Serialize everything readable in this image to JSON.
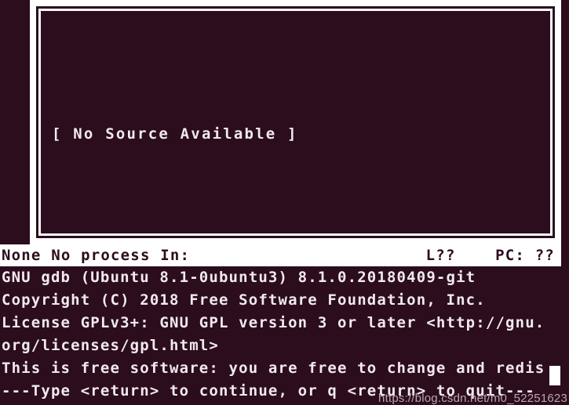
{
  "terminal": {
    "background_color": "#2b0d1e",
    "foreground_color": "#f2e9ee"
  },
  "source_window": {
    "placeholder_text": "[ No Source Available ]"
  },
  "status_bar": {
    "left_text": "None No process In:",
    "line_indicator": "L??",
    "pc_indicator": "PC: ??"
  },
  "console": {
    "lines": [
      "GNU gdb (Ubuntu 8.1-0ubuntu3) 8.1.0.20180409-git",
      "Copyright (C) 2018 Free Software Foundation, Inc.",
      "License GPLv3+: GNU GPL version 3 or later <http://gnu.",
      "org/licenses/gpl.html>",
      "This is free software: you are free to change and redis",
      "---Type <return> to continue, or q <return> to quit---"
    ]
  },
  "watermark": {
    "text": "https://blog.csdn.net/m0_52251623"
  }
}
